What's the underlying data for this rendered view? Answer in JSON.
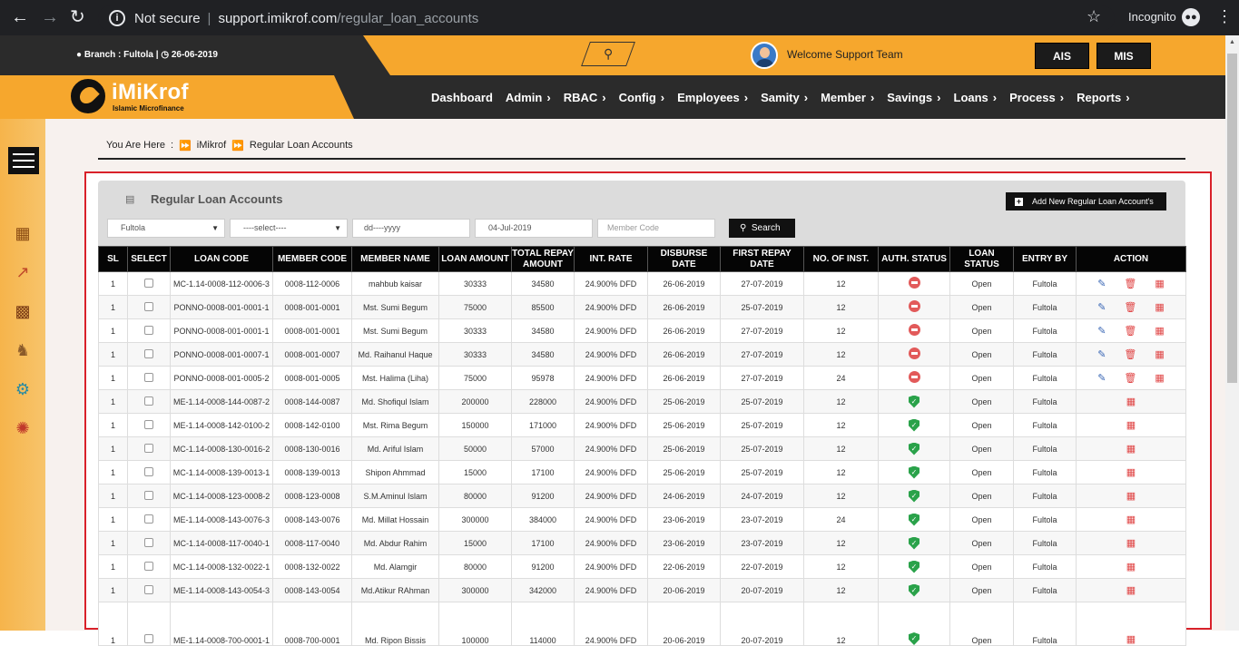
{
  "browser": {
    "secure_label": "Not secure",
    "host": "support.imikrof.com",
    "path": "/regular_loan_accounts",
    "incognito_label": "Incognito"
  },
  "header": {
    "branch_info": "Branch : Fultola |",
    "date": "26-06-2019",
    "welcome": "Welcome Support Team",
    "btn_ais": "AIS",
    "btn_mis": "MIS",
    "logo_title": "iMiKrof",
    "logo_subtitle": "Islamic Microfinance"
  },
  "menu": [
    "Dashboard",
    "Admin",
    "RBAC",
    "Config",
    "Employees",
    "Samity",
    "Member",
    "Savings",
    "Loans",
    "Process",
    "Reports"
  ],
  "breadcrumb": {
    "prefix": "You Are Here",
    "sep": ":",
    "home": "iMikrof",
    "current": "Regular Loan Accounts"
  },
  "panel": {
    "title": "Regular Loan Accounts",
    "add_button": "Add New Regular Loan Account's",
    "filters": {
      "branch": "Fultola",
      "select": "----select----",
      "date_from": "dd----yyyy",
      "date_to": "04-Jul-2019",
      "member_code_placeholder": "Member Code",
      "search": "Search"
    }
  },
  "table": {
    "headers": [
      "SL",
      "SELECT",
      "LOAN CODE",
      "MEMBER CODE",
      "MEMBER NAME",
      "LOAN AMOUNT",
      "TOTAL REPAY AMOUNT",
      "INT. RATE",
      "DISBURSE DATE",
      "FIRST REPAY DATE",
      "NO. OF INST.",
      "AUTH. STATUS",
      "LOAN STATUS",
      "ENTRY BY",
      "ACTION"
    ],
    "rows": [
      {
        "sl": "1",
        "loan_code": "MC-1.14-0008-112-0006-3",
        "member_code": "0008-112-0006",
        "member_name": "mahbub kaisar",
        "loan_amount": "30333",
        "total_repay": "34580",
        "rate": "24.900% DFD",
        "disburse": "26-06-2019",
        "first_repay": "27-07-2019",
        "inst": "12",
        "auth": "pending",
        "loan_status": "Open",
        "entry_by": "Fultola"
      },
      {
        "sl": "1",
        "loan_code": "PONNO-0008-001-0001-1",
        "member_code": "0008-001-0001",
        "member_name": "Mst. Sumi Begum",
        "loan_amount": "75000",
        "total_repay": "85500",
        "rate": "24.900% DFD",
        "disburse": "26-06-2019",
        "first_repay": "25-07-2019",
        "inst": "12",
        "auth": "pending",
        "loan_status": "Open",
        "entry_by": "Fultola"
      },
      {
        "sl": "1",
        "loan_code": "PONNO-0008-001-0001-1",
        "member_code": "0008-001-0001",
        "member_name": "Mst. Sumi Begum",
        "loan_amount": "30333",
        "total_repay": "34580",
        "rate": "24.900% DFD",
        "disburse": "26-06-2019",
        "first_repay": "27-07-2019",
        "inst": "12",
        "auth": "pending",
        "loan_status": "Open",
        "entry_by": "Fultola"
      },
      {
        "sl": "1",
        "loan_code": "PONNO-0008-001-0007-1",
        "member_code": "0008-001-0007",
        "member_name": "Md. Raihanul Haque",
        "loan_amount": "30333",
        "total_repay": "34580",
        "rate": "24.900% DFD",
        "disburse": "26-06-2019",
        "first_repay": "27-07-2019",
        "inst": "12",
        "auth": "pending",
        "loan_status": "Open",
        "entry_by": "Fultola"
      },
      {
        "sl": "1",
        "loan_code": "PONNO-0008-001-0005-2",
        "member_code": "0008-001-0005",
        "member_name": "Mst. Halima (Liha)",
        "loan_amount": "75000",
        "total_repay": "95978",
        "rate": "24.900% DFD",
        "disburse": "26-06-2019",
        "first_repay": "27-07-2019",
        "inst": "24",
        "auth": "pending",
        "loan_status": "Open",
        "entry_by": "Fultola"
      },
      {
        "sl": "1",
        "loan_code": "ME-1.14-0008-144-0087-2",
        "member_code": "0008-144-0087",
        "member_name": "Md. Shofiqul Islam",
        "loan_amount": "200000",
        "total_repay": "228000",
        "rate": "24.900% DFD",
        "disburse": "25-06-2019",
        "first_repay": "25-07-2019",
        "inst": "12",
        "auth": "approved",
        "loan_status": "Open",
        "entry_by": "Fultola"
      },
      {
        "sl": "1",
        "loan_code": "ME-1.14-0008-142-0100-2",
        "member_code": "0008-142-0100",
        "member_name": "Mst. Rima Begum",
        "loan_amount": "150000",
        "total_repay": "171000",
        "rate": "24.900% DFD",
        "disburse": "25-06-2019",
        "first_repay": "25-07-2019",
        "inst": "12",
        "auth": "approved",
        "loan_status": "Open",
        "entry_by": "Fultola"
      },
      {
        "sl": "1",
        "loan_code": "MC-1.14-0008-130-0016-2",
        "member_code": "0008-130-0016",
        "member_name": "Md. Ariful Islam",
        "loan_amount": "50000",
        "total_repay": "57000",
        "rate": "24.900% DFD",
        "disburse": "25-06-2019",
        "first_repay": "25-07-2019",
        "inst": "12",
        "auth": "approved",
        "loan_status": "Open",
        "entry_by": "Fultola"
      },
      {
        "sl": "1",
        "loan_code": "MC-1.14-0008-139-0013-1",
        "member_code": "0008-139-0013",
        "member_name": "Shipon Ahmmad",
        "loan_amount": "15000",
        "total_repay": "17100",
        "rate": "24.900% DFD",
        "disburse": "25-06-2019",
        "first_repay": "25-07-2019",
        "inst": "12",
        "auth": "approved",
        "loan_status": "Open",
        "entry_by": "Fultola"
      },
      {
        "sl": "1",
        "loan_code": "MC-1.14-0008-123-0008-2",
        "member_code": "0008-123-0008",
        "member_name": "S.M.Aminul Islam",
        "loan_amount": "80000",
        "total_repay": "91200",
        "rate": "24.900% DFD",
        "disburse": "24-06-2019",
        "first_repay": "24-07-2019",
        "inst": "12",
        "auth": "approved",
        "loan_status": "Open",
        "entry_by": "Fultola"
      },
      {
        "sl": "1",
        "loan_code": "ME-1.14-0008-143-0076-3",
        "member_code": "0008-143-0076",
        "member_name": "Md. Millat Hossain",
        "loan_amount": "300000",
        "total_repay": "384000",
        "rate": "24.900% DFD",
        "disburse": "23-06-2019",
        "first_repay": "23-07-2019",
        "inst": "24",
        "auth": "approved",
        "loan_status": "Open",
        "entry_by": "Fultola"
      },
      {
        "sl": "1",
        "loan_code": "MC-1.14-0008-117-0040-1",
        "member_code": "0008-117-0040",
        "member_name": "Md. Abdur Rahim",
        "loan_amount": "15000",
        "total_repay": "17100",
        "rate": "24.900% DFD",
        "disburse": "23-06-2019",
        "first_repay": "23-07-2019",
        "inst": "12",
        "auth": "approved",
        "loan_status": "Open",
        "entry_by": "Fultola"
      },
      {
        "sl": "1",
        "loan_code": "MC-1.14-0008-132-0022-1",
        "member_code": "0008-132-0022",
        "member_name": "Md. Alamgir",
        "loan_amount": "80000",
        "total_repay": "91200",
        "rate": "24.900% DFD",
        "disburse": "22-06-2019",
        "first_repay": "22-07-2019",
        "inst": "12",
        "auth": "approved",
        "loan_status": "Open",
        "entry_by": "Fultola"
      },
      {
        "sl": "1",
        "loan_code": "ME-1.14-0008-143-0054-3",
        "member_code": "0008-143-0054",
        "member_name": "Md.Atikur RAhman",
        "loan_amount": "300000",
        "total_repay": "342000",
        "rate": "24.900% DFD",
        "disburse": "20-06-2019",
        "first_repay": "20-07-2019",
        "inst": "12",
        "auth": "approved",
        "loan_status": "Open",
        "entry_by": "Fultola"
      },
      {
        "sl": "1",
        "loan_code": "ME-1.14-0008-700-0001-1",
        "member_code": "0008-700-0001",
        "member_name": "Md. Ripon Bissis",
        "loan_amount": "100000",
        "total_repay": "114000",
        "rate": "24.900% DFD",
        "disburse": "20-06-2019",
        "first_repay": "20-07-2019",
        "inst": "12",
        "auth": "approved",
        "loan_status": "Open",
        "entry_by": "Fultola"
      }
    ]
  }
}
